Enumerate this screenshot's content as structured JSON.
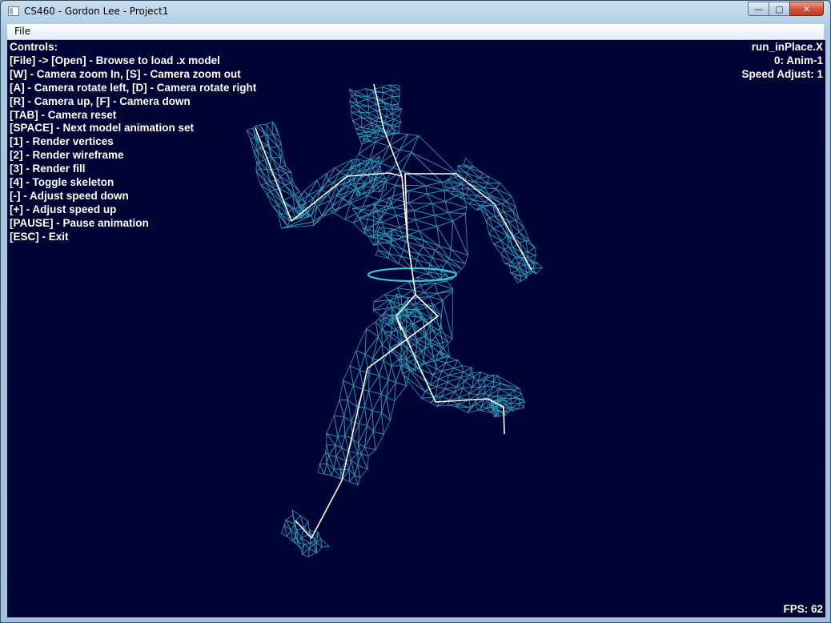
{
  "window": {
    "title": "CS460 - Gordon Lee - Project1",
    "icon": "application-window-icon",
    "caption_buttons": {
      "minimize": "—",
      "maximize": "▢",
      "close": "✕"
    }
  },
  "menu": {
    "items": [
      "File"
    ]
  },
  "hud": {
    "controls_header": "Controls:",
    "controls": [
      "[File] -> [Open] - Browse to load .x model",
      "[W] - Camera zoom In, [S] - Camera zoom out",
      "[A] - Camera rotate left, [D] - Camera rotate right",
      "[R] - Camera up, [F] - Camera down",
      "[TAB] - Camera reset",
      "[SPACE] - Next model animation set",
      "[1] - Render vertices",
      "[2] - Render wireframe",
      "[3] - Render fill",
      "[4] - Toggle skeleton",
      "[-] - Adjust speed down",
      "[+] - Adjust speed up",
      "[PAUSE] - Pause animation",
      "[ESC] - Exit"
    ],
    "model_file": "run_inPlace.X",
    "animation": "0: Anim-1",
    "speed_adjust": "Speed Adjust: 1",
    "fps": "FPS: 62"
  },
  "colors": {
    "viewport_bg": "#000435",
    "wireframe": "#2fa6c2",
    "skeleton": "#ffffff",
    "hud_text": "#ffffff"
  }
}
